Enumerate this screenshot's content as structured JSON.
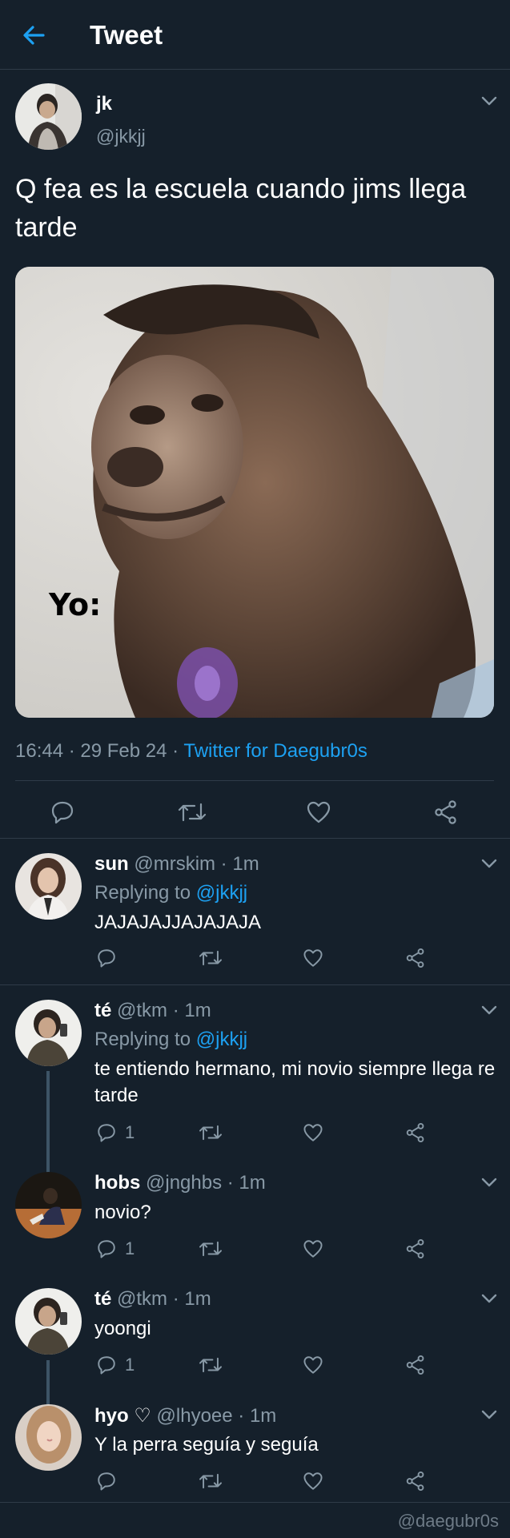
{
  "header": {
    "title": "Tweet",
    "back_icon": "arrow-left-icon"
  },
  "main_tweet": {
    "name": "jk",
    "handle": "@jkkjj",
    "text": "Q fea es la escuela cuando jims llega tarde",
    "media_caption": "Yo:",
    "time": "16:44",
    "date": "29 Feb 24",
    "source": "Twitter for Daegubr0s",
    "meta_sep": " · "
  },
  "replies": [
    {
      "name": "sun",
      "handle": "@mrskim",
      "time": "1m",
      "replying_prefix": "Replying to ",
      "replying_to": "@jkkjj",
      "text": "JAJAJAJJAJAJAJA",
      "reply_count": ""
    },
    {
      "name": "té",
      "handle": "@tkm",
      "time": "1m",
      "replying_prefix": "Replying to ",
      "replying_to": "@jkkjj",
      "text": "te entiendo hermano, mi novio siempre llega re tarde",
      "reply_count": "1"
    },
    {
      "name": "hobs",
      "handle": "@jnghbs",
      "time": "1m",
      "text": "novio?",
      "reply_count": "1"
    },
    {
      "name": "té",
      "handle": "@tkm",
      "time": "1m",
      "text": "yoongi",
      "reply_count": "1"
    },
    {
      "name": "hyo ♡",
      "handle": "@lhyoee",
      "time": "1m",
      "text": "Y la perra seguía y seguía",
      "reply_count": ""
    }
  ],
  "watermark": "@daegubr0s",
  "colors": {
    "background": "#15202b",
    "accent": "#1da1f2",
    "muted": "#8899a6",
    "divider": "#2f3b48"
  }
}
